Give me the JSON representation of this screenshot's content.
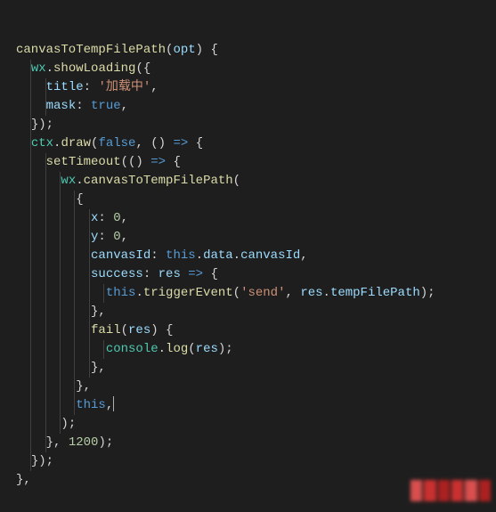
{
  "code": {
    "lines": [
      {
        "indent": 0,
        "tokens": [
          {
            "t": "canvasToTempFilePath",
            "c": "fn"
          },
          {
            "t": "(",
            "c": "punc"
          },
          {
            "t": "opt",
            "c": "param"
          },
          {
            "t": ") {",
            "c": "punc"
          }
        ]
      },
      {
        "indent": 1,
        "tokens": [
          {
            "t": "wx",
            "c": "obj"
          },
          {
            "t": ".",
            "c": "punc"
          },
          {
            "t": "showLoading",
            "c": "fn"
          },
          {
            "t": "({",
            "c": "punc"
          }
        ]
      },
      {
        "indent": 2,
        "tokens": [
          {
            "t": "title",
            "c": "key"
          },
          {
            "t": ": ",
            "c": "punc"
          },
          {
            "t": "'加载中'",
            "c": "str"
          },
          {
            "t": ",",
            "c": "punc"
          }
        ]
      },
      {
        "indent": 2,
        "tokens": [
          {
            "t": "mask",
            "c": "key"
          },
          {
            "t": ": ",
            "c": "punc"
          },
          {
            "t": "true",
            "c": "bool"
          },
          {
            "t": ",",
            "c": "punc"
          }
        ]
      },
      {
        "indent": 1,
        "tokens": [
          {
            "t": "});",
            "c": "punc"
          }
        ]
      },
      {
        "indent": 1,
        "tokens": [
          {
            "t": "ctx",
            "c": "obj"
          },
          {
            "t": ".",
            "c": "punc"
          },
          {
            "t": "draw",
            "c": "fn"
          },
          {
            "t": "(",
            "c": "punc"
          },
          {
            "t": "false",
            "c": "bool"
          },
          {
            "t": ", () ",
            "c": "punc"
          },
          {
            "t": "=>",
            "c": "kw"
          },
          {
            "t": " {",
            "c": "punc"
          }
        ]
      },
      {
        "indent": 2,
        "tokens": [
          {
            "t": "setTimeout",
            "c": "fn"
          },
          {
            "t": "(() ",
            "c": "punc"
          },
          {
            "t": "=>",
            "c": "kw"
          },
          {
            "t": " {",
            "c": "punc"
          }
        ]
      },
      {
        "indent": 3,
        "tokens": [
          {
            "t": "wx",
            "c": "obj"
          },
          {
            "t": ".",
            "c": "punc"
          },
          {
            "t": "canvasToTempFilePath",
            "c": "fn"
          },
          {
            "t": "(",
            "c": "punc"
          }
        ]
      },
      {
        "indent": 4,
        "tokens": [
          {
            "t": "{",
            "c": "punc"
          }
        ]
      },
      {
        "indent": 5,
        "tokens": [
          {
            "t": "x",
            "c": "key"
          },
          {
            "t": ": ",
            "c": "punc"
          },
          {
            "t": "0",
            "c": "num"
          },
          {
            "t": ",",
            "c": "punc"
          }
        ]
      },
      {
        "indent": 5,
        "tokens": [
          {
            "t": "y",
            "c": "key"
          },
          {
            "t": ": ",
            "c": "punc"
          },
          {
            "t": "0",
            "c": "num"
          },
          {
            "t": ",",
            "c": "punc"
          }
        ]
      },
      {
        "indent": 5,
        "tokens": [
          {
            "t": "canvasId",
            "c": "key"
          },
          {
            "t": ": ",
            "c": "punc"
          },
          {
            "t": "this",
            "c": "this"
          },
          {
            "t": ".",
            "c": "punc"
          },
          {
            "t": "data",
            "c": "prop"
          },
          {
            "t": ".",
            "c": "punc"
          },
          {
            "t": "canvasId",
            "c": "prop"
          },
          {
            "t": ",",
            "c": "punc"
          }
        ]
      },
      {
        "indent": 5,
        "tokens": [
          {
            "t": "success",
            "c": "key"
          },
          {
            "t": ": ",
            "c": "punc"
          },
          {
            "t": "res",
            "c": "param"
          },
          {
            "t": " ",
            "c": "punc"
          },
          {
            "t": "=>",
            "c": "kw"
          },
          {
            "t": " {",
            "c": "punc"
          }
        ]
      },
      {
        "indent": 6,
        "tokens": [
          {
            "t": "this",
            "c": "this"
          },
          {
            "t": ".",
            "c": "punc"
          },
          {
            "t": "triggerEvent",
            "c": "fn"
          },
          {
            "t": "(",
            "c": "punc"
          },
          {
            "t": "'send'",
            "c": "str"
          },
          {
            "t": ", ",
            "c": "punc"
          },
          {
            "t": "res",
            "c": "param"
          },
          {
            "t": ".",
            "c": "punc"
          },
          {
            "t": "tempFilePath",
            "c": "prop"
          },
          {
            "t": ");",
            "c": "punc"
          }
        ]
      },
      {
        "indent": 5,
        "tokens": [
          {
            "t": "},",
            "c": "punc"
          }
        ]
      },
      {
        "indent": 5,
        "tokens": [
          {
            "t": "fail",
            "c": "fn"
          },
          {
            "t": "(",
            "c": "punc"
          },
          {
            "t": "res",
            "c": "param"
          },
          {
            "t": ") {",
            "c": "punc"
          }
        ]
      },
      {
        "indent": 6,
        "tokens": [
          {
            "t": "console",
            "c": "obj"
          },
          {
            "t": ".",
            "c": "punc"
          },
          {
            "t": "log",
            "c": "fn"
          },
          {
            "t": "(",
            "c": "punc"
          },
          {
            "t": "res",
            "c": "param"
          },
          {
            "t": ");",
            "c": "punc"
          }
        ]
      },
      {
        "indent": 5,
        "tokens": [
          {
            "t": "},",
            "c": "punc"
          }
        ]
      },
      {
        "indent": 4,
        "tokens": [
          {
            "t": "},",
            "c": "punc"
          }
        ]
      },
      {
        "indent": 4,
        "tokens": [
          {
            "t": "this",
            "c": "this"
          },
          {
            "t": ",",
            "c": "punc"
          }
        ],
        "cursor": true
      },
      {
        "indent": 3,
        "tokens": [
          {
            "t": ");",
            "c": "punc"
          }
        ]
      },
      {
        "indent": 2,
        "tokens": [
          {
            "t": "}, ",
            "c": "punc"
          },
          {
            "t": "1200",
            "c": "num"
          },
          {
            "t": ");",
            "c": "punc"
          }
        ]
      },
      {
        "indent": 1,
        "tokens": [
          {
            "t": "});",
            "c": "punc"
          }
        ]
      },
      {
        "indent": 0,
        "tokens": [
          {
            "t": "},",
            "c": "punc"
          }
        ]
      }
    ],
    "indent_unit": "  "
  },
  "theme": {
    "background": "#1e1e1e",
    "foreground": "#d4d4d4",
    "guide": "#404040",
    "function": "#dcdcaa",
    "variable": "#9cdcfe",
    "class": "#4ec9b0",
    "string": "#ce9178",
    "number": "#b5cea8",
    "keyword": "#569cd6"
  }
}
